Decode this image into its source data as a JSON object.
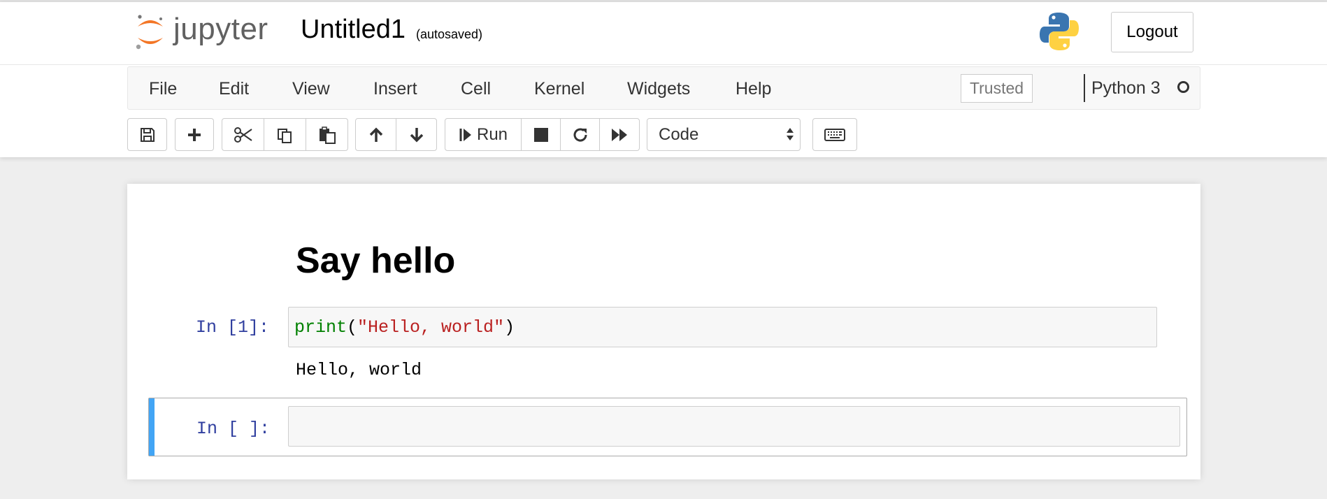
{
  "header": {
    "logo_text": "jupyter",
    "notebook_name": "Untitled1",
    "autosave_status": "(autosaved)",
    "logout_label": "Logout",
    "brand_color": "#f37626"
  },
  "menubar": {
    "items": [
      "File",
      "Edit",
      "View",
      "Insert",
      "Cell",
      "Kernel",
      "Widgets",
      "Help"
    ],
    "trusted_label": "Trusted",
    "kernel_name": "Python 3"
  },
  "toolbar": {
    "icons": [
      "save-icon",
      "plus-icon",
      "cut-icon",
      "copy-icon",
      "paste-icon",
      "arrow-up-icon",
      "arrow-down-icon",
      "step-forward-icon",
      "stop-icon",
      "refresh-icon",
      "fast-forward-icon",
      "keyboard-icon"
    ],
    "run_label": "Run",
    "cell_type": "Code"
  },
  "notebook": {
    "markdown_heading": "Say hello",
    "cells": [
      {
        "prompt": "In [1]:",
        "tokens": {
          "fn": "print",
          "open": "(",
          "str": "\"Hello, world\"",
          "close": ")"
        },
        "output": "Hello, world"
      },
      {
        "prompt": "In [ ]:",
        "selected_color": "#42a5f5"
      }
    ]
  }
}
